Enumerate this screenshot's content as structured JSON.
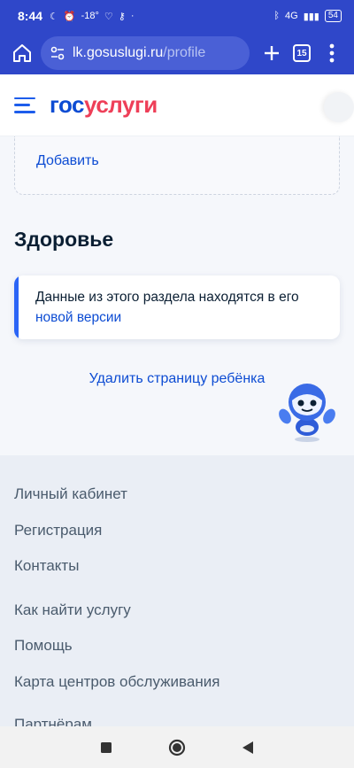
{
  "status_bar": {
    "time": "8:44",
    "temperature": "-18°",
    "network": "4G",
    "battery": "54"
  },
  "browser": {
    "url_host": "lk.gosuslugi.ru",
    "url_path": "/profile",
    "tab_count": "15"
  },
  "site": {
    "logo_gos": "гос",
    "logo_uslugi": "услуги"
  },
  "main": {
    "add_link": "Добавить",
    "section_title": "Здоровье",
    "info_text": "Данные из этого раздела находятся в его",
    "info_link": "новой версии",
    "delete_link": "Удалить страницу ребёнка"
  },
  "footer": {
    "items": [
      "Личный кабинет",
      "Регистрация",
      "Контакты",
      "Как найти услугу",
      "Помощь",
      "Карта центров обслуживания",
      "Партнёрам"
    ]
  },
  "icons": {
    "home": "home-icon",
    "site_settings": "site-settings-icon",
    "new_tab": "plus-icon",
    "menu": "more-vert-icon",
    "burger": "burger-menu-icon",
    "assistant": "robot-assistant-icon"
  },
  "colors": {
    "browser_bar": "#2f47c9",
    "link": "#0d4cd3",
    "logo_red": "#ee3f58",
    "accent_bar": "#2a64f6"
  }
}
